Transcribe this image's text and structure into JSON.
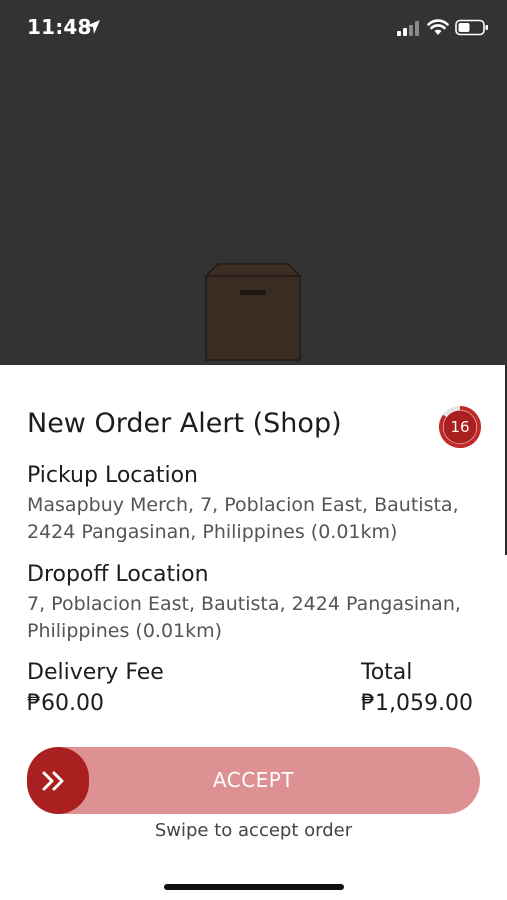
{
  "status_bar": {
    "time": "11:48",
    "icons": [
      "location-arrow-icon",
      "cellular-signal-icon",
      "wifi-icon",
      "battery-icon"
    ]
  },
  "backdrop": {
    "icon": "box-icon"
  },
  "alert": {
    "title": "New Order Alert (Shop)",
    "countdown": "16",
    "countdown_fraction_remaining": 0.85,
    "pickup": {
      "label": "Pickup Location",
      "address_line1": "Masapbuy Merch, 7, Poblacion East, Bautista,",
      "address_line2": "2424 Pangasinan, Philippines (0.01km)"
    },
    "dropoff": {
      "label": "Dropoff Location",
      "address_line1": "7, Poblacion East, Bautista, 2424 Pangasinan,",
      "address_line2": "Philippines (0.01km)"
    },
    "delivery_fee": {
      "label": "Delivery Fee",
      "value": "₱60.00"
    },
    "total": {
      "label": "Total",
      "value": "₱1,059.00"
    },
    "accept_slider": {
      "label": "ACCEPT",
      "hint": "Swipe to accept order",
      "handle_icon": "double-chevron-right-icon"
    }
  },
  "colors": {
    "accent": "#aa1f1f",
    "slider_track": "#de9192",
    "backdrop": "#333333"
  }
}
